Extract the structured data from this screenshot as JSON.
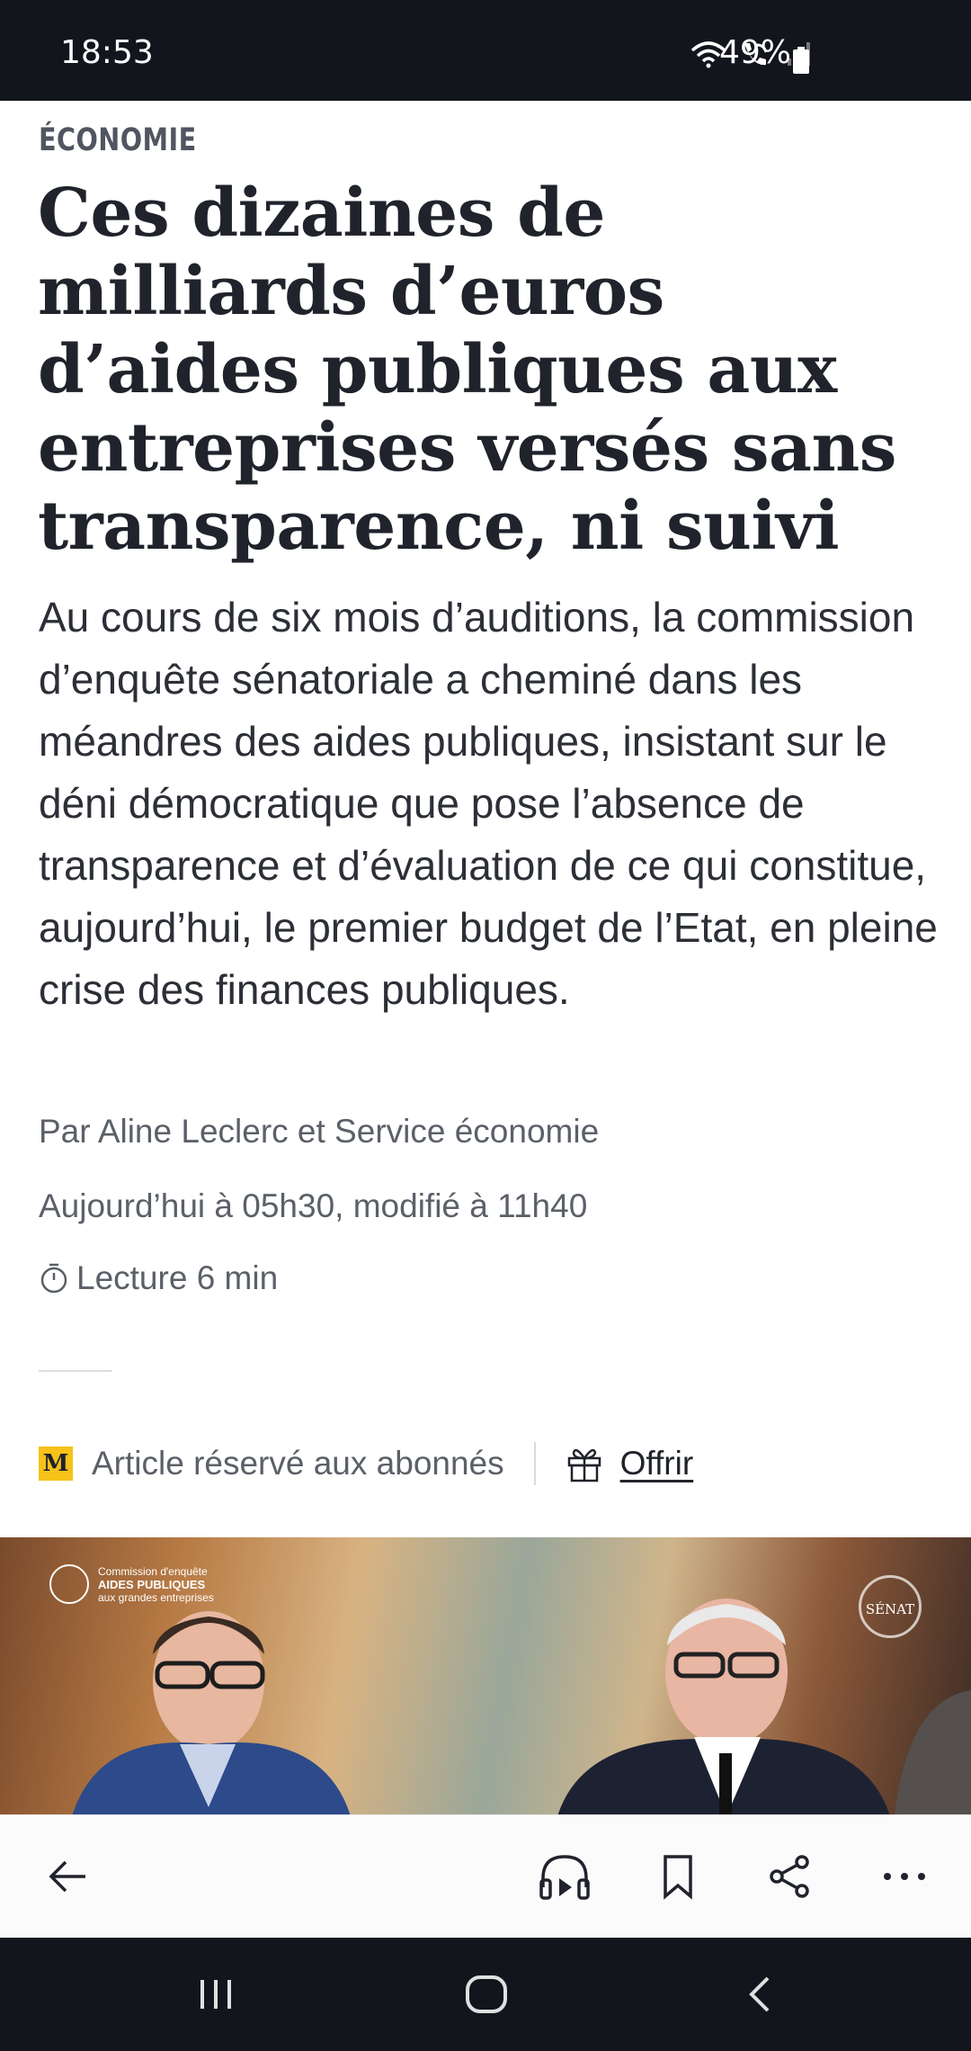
{
  "status_bar": {
    "time": "18:53",
    "battery": "49%"
  },
  "article": {
    "section": "ÉCONOMIE",
    "headline": "Ces dizaines de milliards d’euros d’aides publiques aux entreprises versés sans transparence, ni suivi",
    "lead": "Au cours de six mois d’auditions, la commission d’enquête sénatoriale a cheminé dans les méandres des aides publiques, insistant sur le déni démocratique que pose l’absence de transparence et d’évaluation de ce qui constitue, aujourd’hui, le premier budget de l’Etat, en pleine crise des finances publiques.",
    "byline": "Par Aline Leclerc et Service économie",
    "dateline": "Aujourd’hui à 05h30, modifié à 11h40",
    "reading_time": "Lecture 6 min",
    "subscriber_badge": "M",
    "subscriber_label": "Article réservé aux abonnés",
    "offer_label": "Offrir"
  },
  "photo": {
    "overlay_line1": "Commission d'enquête",
    "overlay_line2": "AIDES PUBLIQUES",
    "overlay_line3": "aux grandes entreprises",
    "senat_logo": "SÉNAT"
  },
  "toolbar": {
    "icons": [
      "back-arrow-icon",
      "headphones-icon",
      "bookmark-icon",
      "share-icon",
      "more-icon"
    ]
  },
  "nav_bar": {
    "icons": [
      "recent-apps-icon",
      "home-icon",
      "back-icon"
    ]
  },
  "colors": {
    "headline": "#20232b",
    "meta": "#5b6068",
    "badge": "#f6c21a",
    "system_bar": "#13151d"
  }
}
